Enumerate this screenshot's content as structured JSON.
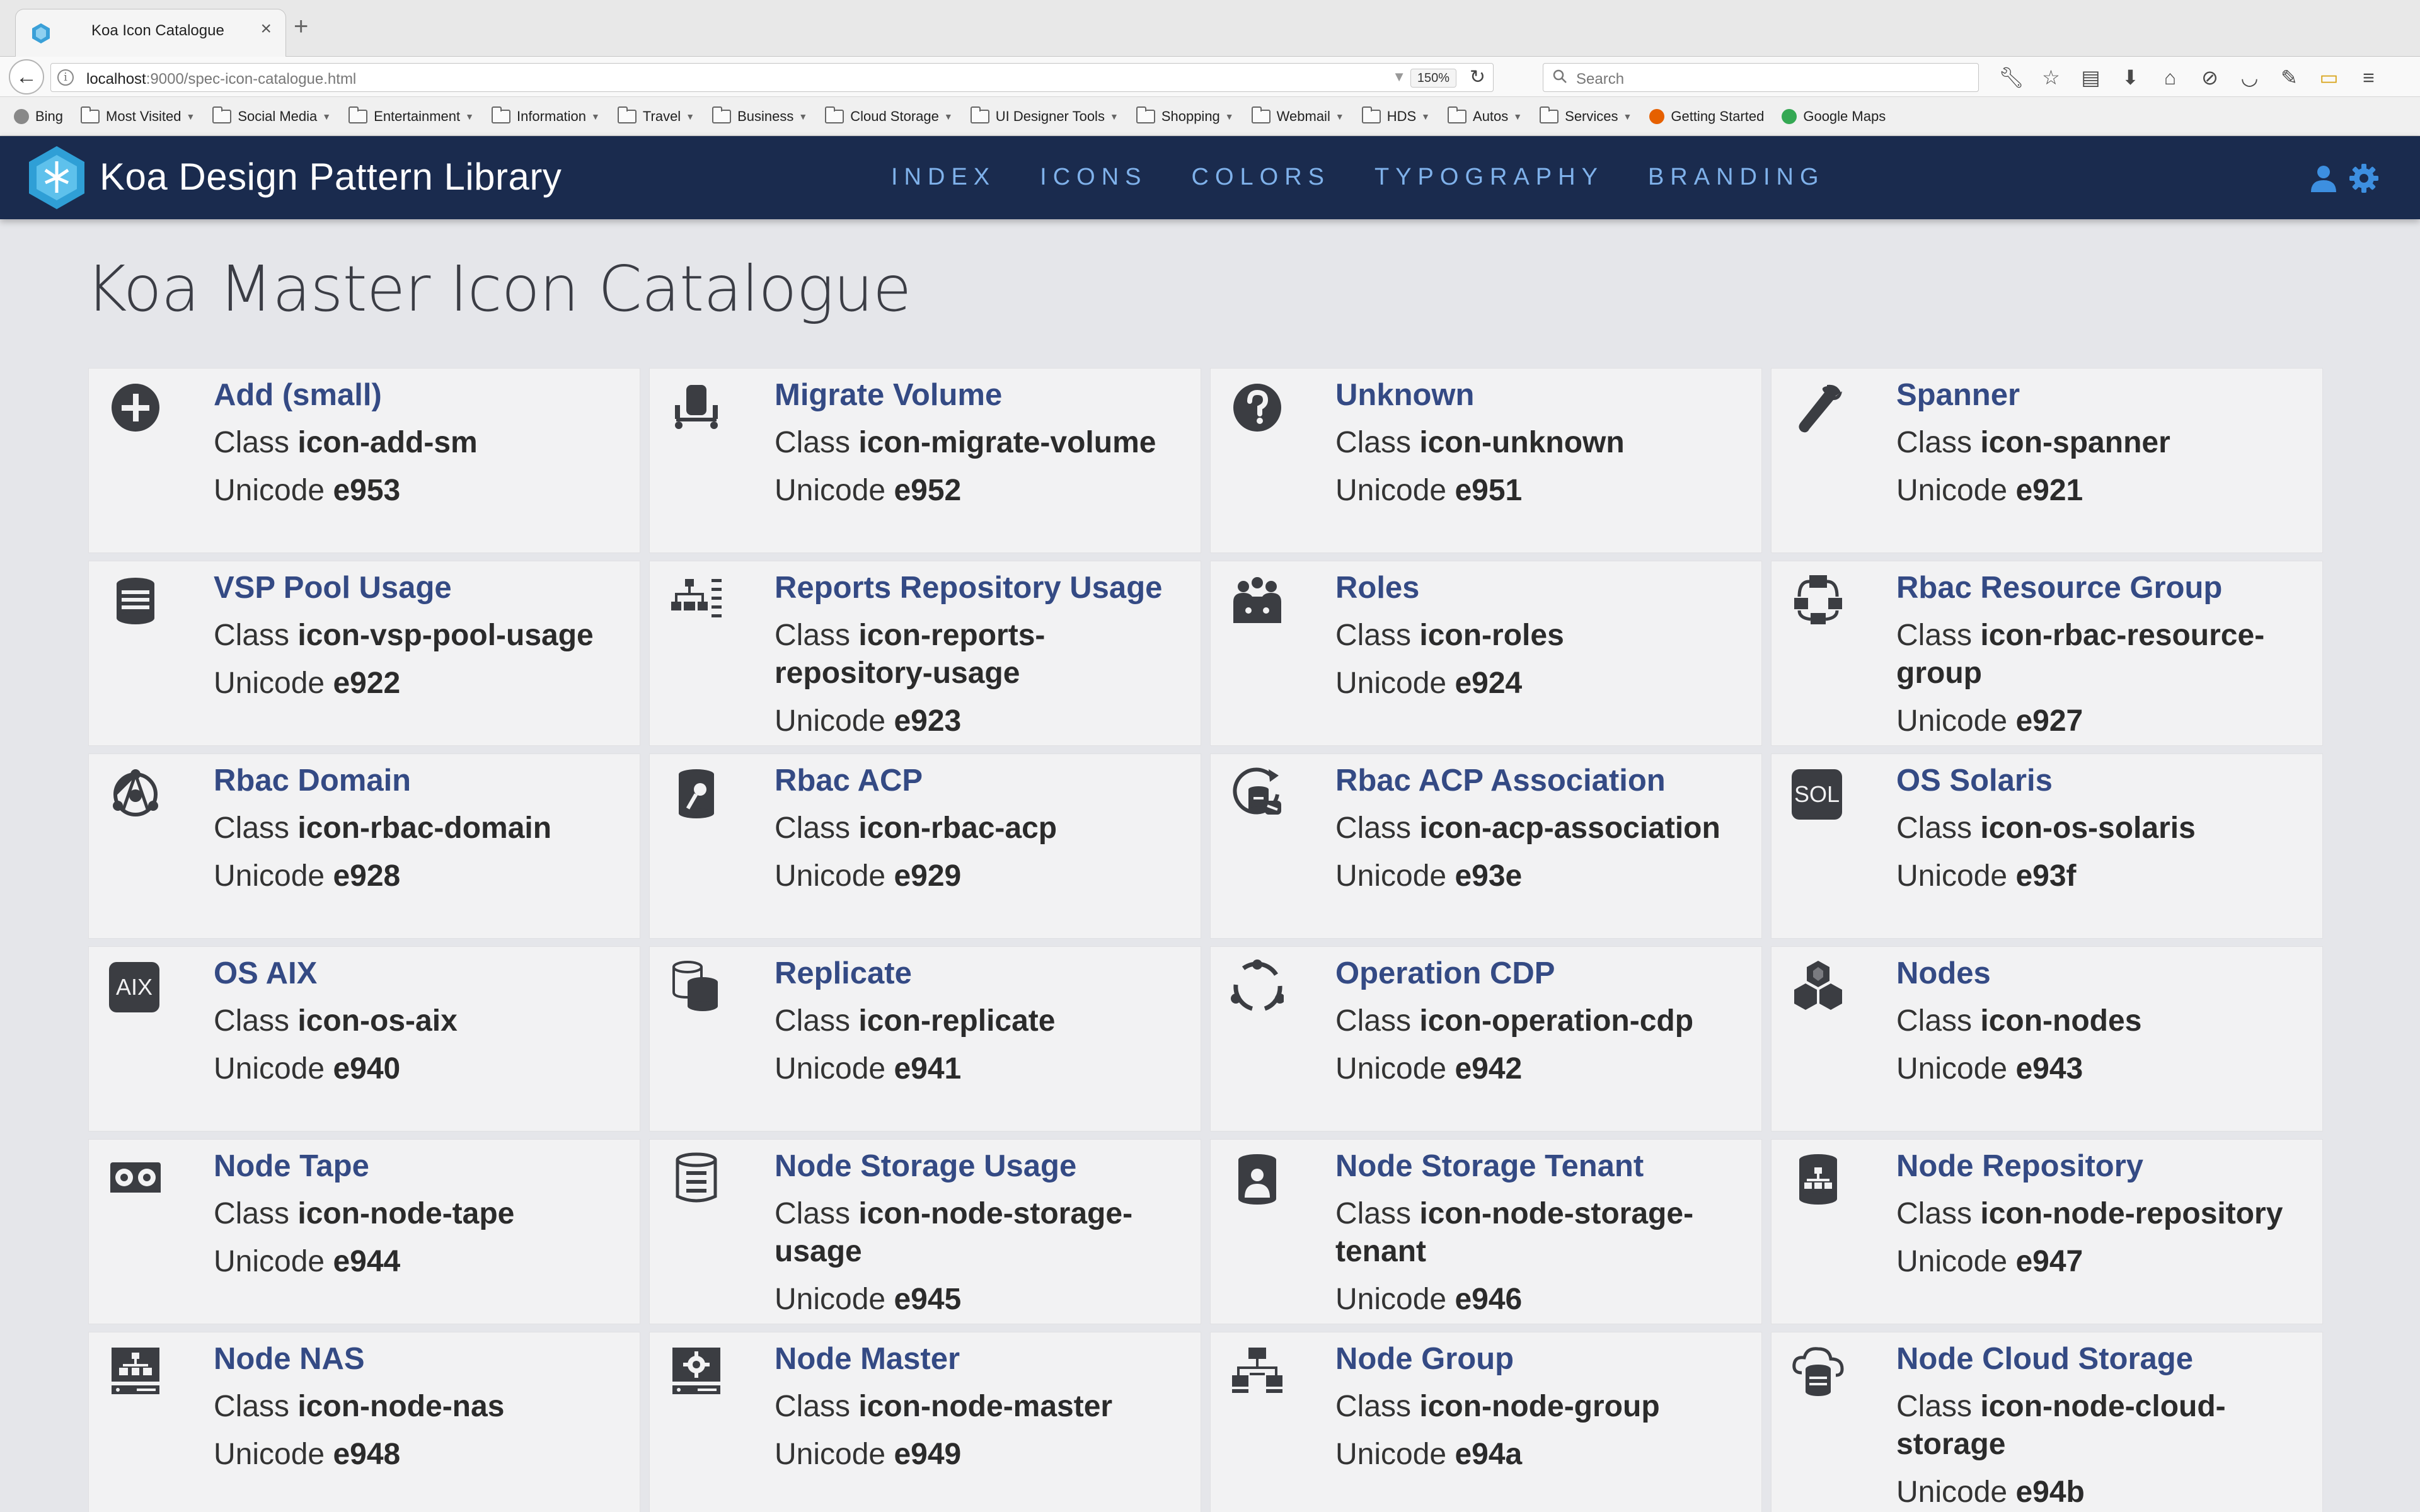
{
  "browser": {
    "tab_title": "Koa Icon Catalogue",
    "new_tab": "+",
    "url_host": "localhost",
    "url_rest": ":9000/spec-icon-catalogue.html",
    "zoom": "150%",
    "search_placeholder": "Search",
    "bookmarks": [
      {
        "label": "Bing",
        "type": "site",
        "color": "#888888"
      },
      {
        "label": "Most Visited",
        "type": "folder-menu"
      },
      {
        "label": "Social Media",
        "type": "folder-menu"
      },
      {
        "label": "Entertainment",
        "type": "folder-menu"
      },
      {
        "label": "Information",
        "type": "folder-menu"
      },
      {
        "label": "Travel",
        "type": "folder-menu"
      },
      {
        "label": "Business",
        "type": "folder-menu"
      },
      {
        "label": "Cloud Storage",
        "type": "folder-menu"
      },
      {
        "label": "UI Designer Tools",
        "type": "folder-menu"
      },
      {
        "label": "Shopping",
        "type": "folder-menu"
      },
      {
        "label": "Webmail",
        "type": "folder-menu"
      },
      {
        "label": "HDS",
        "type": "folder-menu"
      },
      {
        "label": "Autos",
        "type": "folder-menu"
      },
      {
        "label": "Services",
        "type": "folder-menu"
      },
      {
        "label": "Getting Started",
        "type": "site",
        "color": "#e66000"
      },
      {
        "label": "Google Maps",
        "type": "site",
        "color": "#34a853"
      }
    ]
  },
  "header": {
    "brand": "Koa Design Pattern Library",
    "nav": [
      "INDEX",
      "ICONS",
      "COLORS",
      "TYPOGRAPHY",
      "BRANDING"
    ],
    "colors": {
      "bar": "#1a2b4e",
      "nav_link": "#7fb1ea",
      "icon": "#3d8fe0"
    }
  },
  "page": {
    "title": "Koa Master Icon Catalogue",
    "class_label": "Class",
    "unicode_label": "Unicode"
  },
  "icons": [
    {
      "name": "Add (small)",
      "class": "icon-add-sm",
      "unicode": "e953",
      "icon": "add-circle"
    },
    {
      "name": "Migrate Volume",
      "class": "icon-migrate-volume",
      "unicode": "e952",
      "icon": "migrate"
    },
    {
      "name": "Unknown",
      "class": "icon-unknown",
      "unicode": "e951",
      "icon": "question"
    },
    {
      "name": "Spanner",
      "class": "icon-spanner",
      "unicode": "e921",
      "icon": "spanner"
    },
    {
      "name": "VSP Pool Usage",
      "class": "icon-vsp-pool-usage",
      "unicode": "e922",
      "icon": "pool"
    },
    {
      "name": "Reports Repository Usage",
      "class": "icon-reports-repository-usage",
      "unicode": "e923",
      "icon": "reports"
    },
    {
      "name": "Roles",
      "class": "icon-roles",
      "unicode": "e924",
      "icon": "roles"
    },
    {
      "name": "Rbac Resource Group",
      "class": "icon-rbac-resource-group",
      "unicode": "e927",
      "icon": "resource-group"
    },
    {
      "name": "Rbac Domain",
      "class": "icon-rbac-domain",
      "unicode": "e928",
      "icon": "domain"
    },
    {
      "name": "Rbac ACP",
      "class": "icon-rbac-acp",
      "unicode": "e929",
      "icon": "acp"
    },
    {
      "name": "Rbac ACP Association",
      "class": "icon-acp-association",
      "unicode": "e93e",
      "icon": "acp-association"
    },
    {
      "name": "OS Solaris",
      "class": "icon-os-solaris",
      "unicode": "e93f",
      "icon": "badge",
      "badge_text": "SOL"
    },
    {
      "name": "OS AIX",
      "class": "icon-os-aix",
      "unicode": "e940",
      "icon": "badge",
      "badge_text": "AIX"
    },
    {
      "name": "Replicate",
      "class": "icon-replicate",
      "unicode": "e941",
      "icon": "replicate"
    },
    {
      "name": "Operation CDP",
      "class": "icon-operation-cdp",
      "unicode": "e942",
      "icon": "cdp"
    },
    {
      "name": "Nodes",
      "class": "icon-nodes",
      "unicode": "e943",
      "icon": "nodes"
    },
    {
      "name": "Node Tape",
      "class": "icon-node-tape",
      "unicode": "e944",
      "icon": "tape"
    },
    {
      "name": "Node Storage Usage",
      "class": "icon-node-storage-usage",
      "unicode": "e945",
      "icon": "storage-usage"
    },
    {
      "name": "Node Storage Tenant",
      "class": "icon-node-storage-tenant",
      "unicode": "e946",
      "icon": "storage-tenant"
    },
    {
      "name": "Node Repository",
      "class": "icon-node-repository",
      "unicode": "e947",
      "icon": "repository"
    },
    {
      "name": "Node NAS",
      "class": "icon-node-nas",
      "unicode": "e948",
      "icon": "nas"
    },
    {
      "name": "Node Master",
      "class": "icon-node-master",
      "unicode": "e949",
      "icon": "master"
    },
    {
      "name": "Node Group",
      "class": "icon-node-group",
      "unicode": "e94a",
      "icon": "group"
    },
    {
      "name": "Node Cloud Storage",
      "class": "icon-node-cloud-storage",
      "unicode": "e94b",
      "icon": "cloud-storage"
    }
  ]
}
